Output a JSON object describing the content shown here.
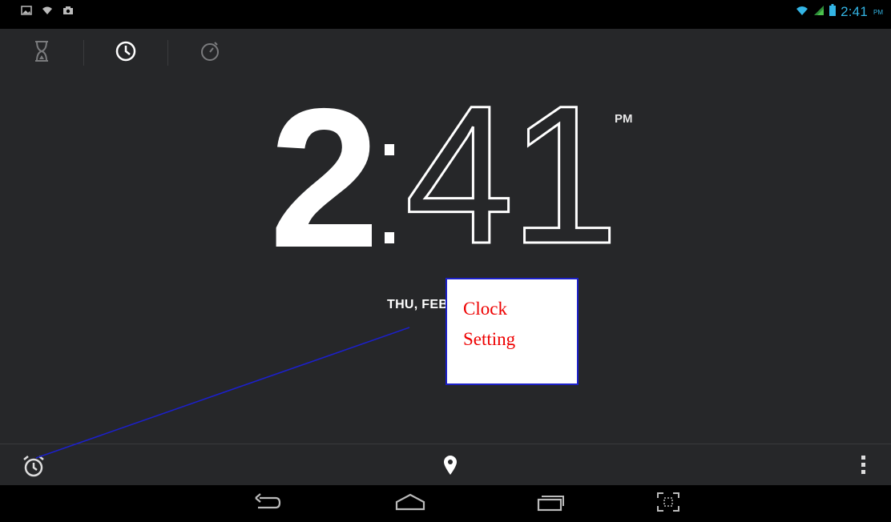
{
  "status_bar": {
    "left_icons": [
      "picture-notification-icon",
      "wifi-notification-icon",
      "camera-notification-icon"
    ],
    "right_icons": [
      "wifi-icon",
      "signal-icon",
      "battery-icon"
    ],
    "time": "2:41",
    "ampm": "PM"
  },
  "tabs": [
    {
      "icon": "timer-icon",
      "selected": false
    },
    {
      "icon": "clock-icon",
      "selected": true
    },
    {
      "icon": "stopwatch-icon",
      "selected": false
    }
  ],
  "clock": {
    "hour": "2",
    "minutes": "41",
    "ampm": "PM",
    "date": "THU, FEB"
  },
  "callout": {
    "line1": "Clock",
    "line2": "Setting",
    "border_color": "#1c20c8",
    "text_color": "#e00000"
  },
  "bottom_bar": {
    "left_icon": "alarm-icon",
    "center_icon": "location-pin-icon",
    "right_icon": "overflow-menu-icon"
  },
  "nav_bar": {
    "buttons": [
      "back-icon",
      "home-icon",
      "recent-apps-icon",
      "screenshot-icon"
    ]
  },
  "colors": {
    "accent": "#33b5e5",
    "background": "#262729",
    "annotation_line": "#1c20c8"
  }
}
